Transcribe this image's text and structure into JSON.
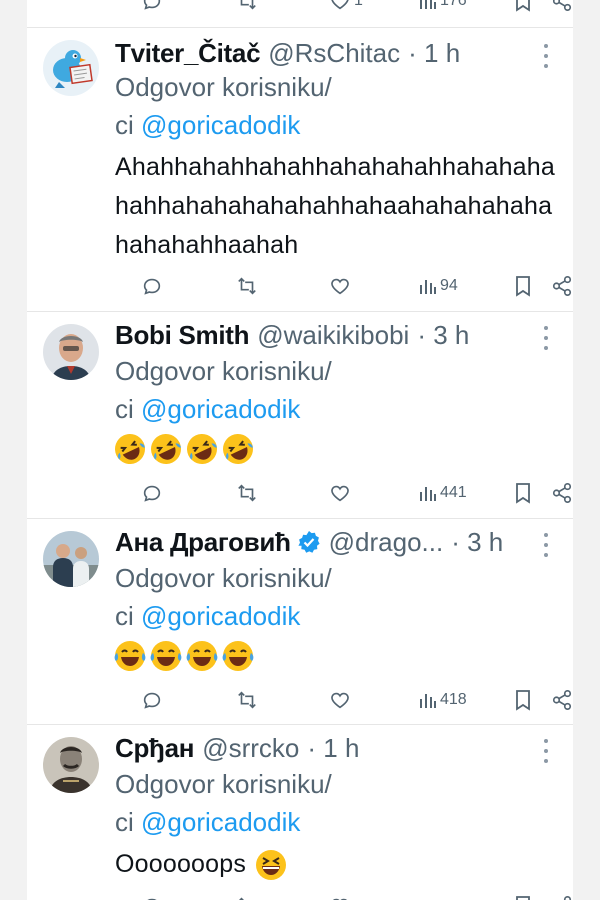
{
  "colors": {
    "accent": "#1d9bf0",
    "text": "#0f1419",
    "muted": "#536471"
  },
  "top_partial": {
    "likes": "1",
    "views": "176"
  },
  "tweets": [
    {
      "name": "Tviter_Čitač",
      "handle": "@RsChitac",
      "time": "· 1 h",
      "reply_prefix": "Odgovor korisniku/",
      "reply_line2": "ci",
      "mention": "@goricadodik",
      "text": "Ahahhahahhahahhahahahahhahahahahahhahahahahahahhahaahahahahahahahahahhaahah",
      "views": "94",
      "avatar_icon": "bird-reading-newspaper-icon"
    },
    {
      "name": "Bobi Smith",
      "handle": "@waikikibobi",
      "time": "· 3 h",
      "reply_prefix": "Odgovor korisniku/",
      "reply_line2": "ci",
      "mention": "@goricadodik",
      "emoji": [
        "rofl",
        "rofl",
        "rofl",
        "rofl"
      ],
      "views": "441",
      "avatar_icon": "man-portrait-icon"
    },
    {
      "name": "Ана Драговић",
      "handle": "@drago...",
      "time": "· 3 h",
      "verified": true,
      "reply_prefix": "Odgovor korisniku/",
      "reply_line2": "ci",
      "mention": "@goricadodik",
      "emoji": [
        "tears-of-joy",
        "tears-of-joy",
        "tears-of-joy",
        "tears-of-joy"
      ],
      "views": "418",
      "avatar_icon": "two-men-portrait-icon"
    },
    {
      "name": "Срђан",
      "handle": "@srrcko",
      "time": "· 1 h",
      "reply_prefix": "Odgovor korisniku/",
      "reply_line2": "ci",
      "mention": "@goricadodik",
      "text": "Ooooooops",
      "text_emoji": "grinning-squinting",
      "avatar_icon": "vintage-portrait-icon"
    }
  ]
}
